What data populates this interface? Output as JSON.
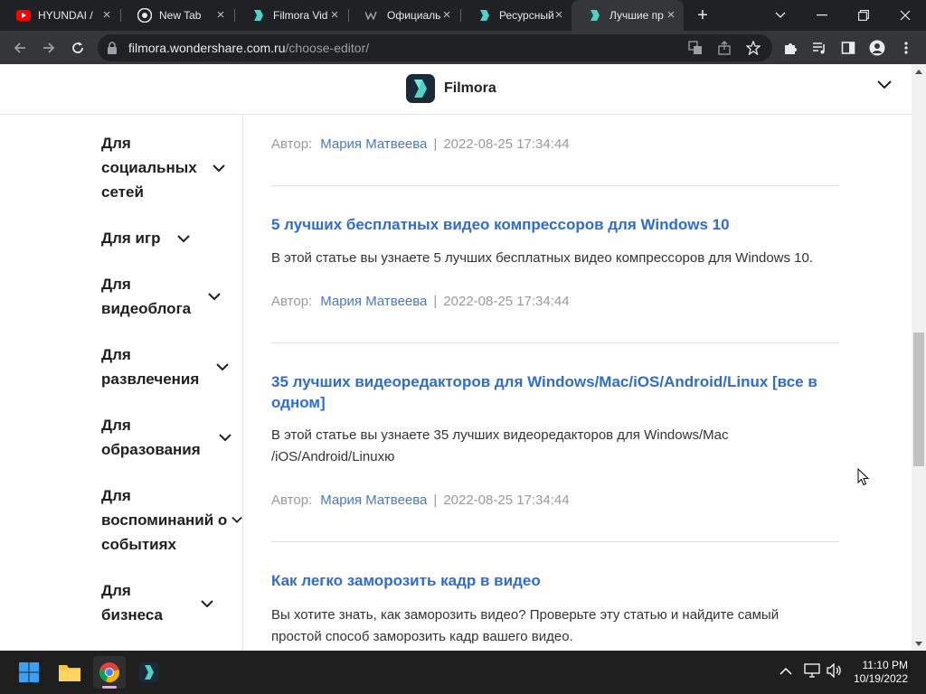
{
  "browser": {
    "tabs": [
      {
        "title": "HYUNDAI /",
        "icon": "youtube-icon"
      },
      {
        "title": "New Tab",
        "icon": "chrome-icon"
      },
      {
        "title": "Filmora Vid",
        "icon": "filmora-icon"
      },
      {
        "title": "Официаль",
        "icon": "wondershare-icon"
      },
      {
        "title": "Ресурсный",
        "icon": "filmora-icon"
      },
      {
        "title": "Лучшие пр",
        "icon": "filmora-icon",
        "active": true
      }
    ],
    "url_host": "filmora.wondershare.com.ru",
    "url_path": "/choose-editor/"
  },
  "site": {
    "logo_text": "Filmora"
  },
  "sidebar": {
    "categories": [
      {
        "label": "Для социальных сетей"
      },
      {
        "label": "Для игр"
      },
      {
        "label": "Для видеоблога"
      },
      {
        "label": "Для развлечения"
      },
      {
        "label": "Для образования"
      },
      {
        "label": "Для воспоминаний о событиях"
      },
      {
        "label": "Для бизнеса"
      }
    ]
  },
  "articles": {
    "meta_label": "Автор:",
    "author": "Мария Матвеева",
    "separator": "|",
    "date": "2022-08-25 17:34:44",
    "items": [
      {
        "title": "5 лучших бесплатных видео компрессоров для Windows 10",
        "description": "В этой статье вы узнаете 5 лучших бесплатных видео компрессоров для Windows 10."
      },
      {
        "title": "35 лучших видеоредакторов для Windows/Mac/iOS/Android/Linux [все в одном]",
        "description": "В этой статье вы узнаете 35 лучших видеоредакторов для Windows/Mac /iOS/Android/Linuxю"
      },
      {
        "title": "Как легко заморозить кадр в видео",
        "description": "Вы хотите знать, как заморозить видео? Проверьте эту статью и найдите самый простой способ заморозить кадр вашего видео."
      }
    ]
  },
  "taskbar": {
    "time": "11:10 PM",
    "date": "10/19/2022"
  },
  "colors": {
    "link_blue": "#2f6dcb",
    "author_blue": "#4a7ab8",
    "chrome_dark": "#202124",
    "chrome_toolbar": "#35363a"
  }
}
